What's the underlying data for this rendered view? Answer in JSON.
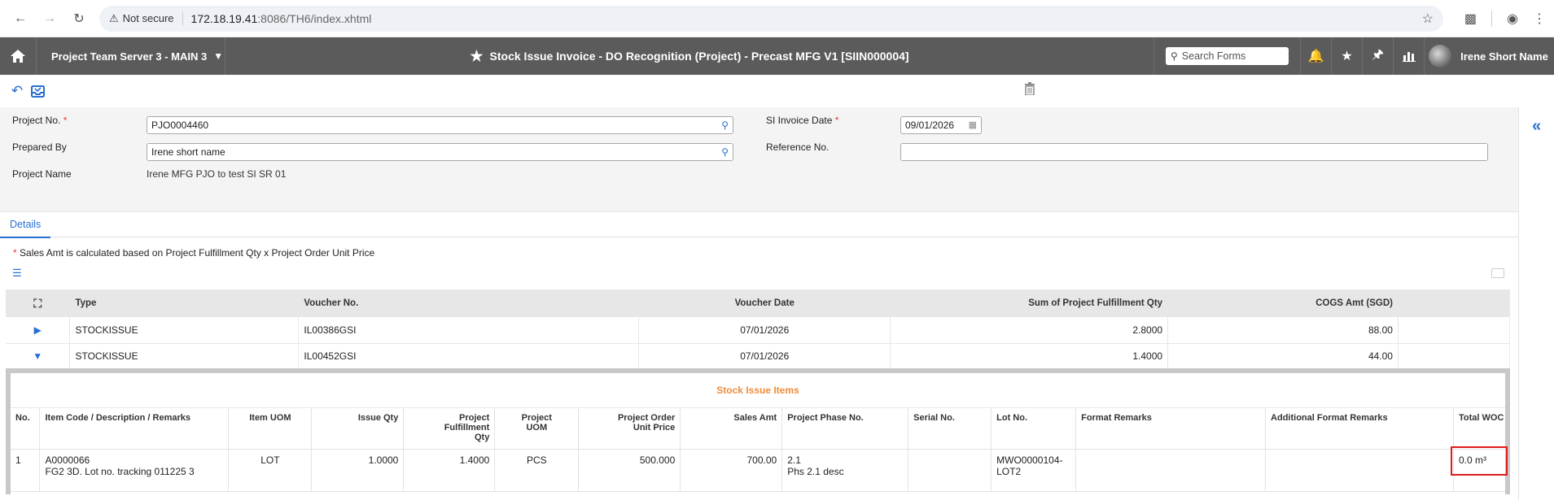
{
  "browser": {
    "security_label": "Not secure",
    "url_host": "172.18.19.41",
    "url_path": ":8086/TH6/index.xhtml"
  },
  "header": {
    "server": "Project Team Server 3 - MAIN 3",
    "title": "Stock Issue Invoice - DO Recognition (Project) - Precast MFG V1 [SIIN000004]",
    "search_placeholder": "Search Forms",
    "user": "Irene Short Name"
  },
  "form": {
    "project_no_label": "Project No.",
    "project_no_value": "PJO0004460",
    "prepared_by_label": "Prepared By",
    "prepared_by_value": "Irene short name",
    "project_name_label": "Project Name",
    "project_name_value": "Irene MFG PJO to test SI SR 01",
    "si_date_label": "SI Invoice Date",
    "si_date_value": "09/01/2026",
    "reference_label": "Reference No.",
    "reference_value": "",
    "required_mark": "*"
  },
  "tabs": [
    {
      "label": "Details"
    }
  ],
  "note": {
    "star": "*",
    "text": "Sales Amt is calculated based on Project Fulfillment Qty x Project Order Unit Price"
  },
  "main_table": {
    "columns": [
      "Type",
      "Voucher No.",
      "Voucher Date",
      "Sum of Project Fulfillment Qty",
      "COGS Amt (SGD)"
    ],
    "rows": [
      {
        "type": "STOCKISSUE",
        "voucher_no": "IL00386GSI",
        "date": "07/01/2026",
        "qty": "2.8000",
        "cogs": "88.00",
        "expanded": false
      },
      {
        "type": "STOCKISSUE",
        "voucher_no": "IL00452GSI",
        "date": "07/01/2026",
        "qty": "1.4000",
        "cogs": "44.00",
        "expanded": true
      }
    ]
  },
  "nested": {
    "title": "Stock Issue Items",
    "columns": {
      "no": "No.",
      "item": "Item Code / Description / Remarks",
      "uom": "Item UOM",
      "issue_qty": "Issue Qty",
      "pf_qty_1": "Project",
      "pf_qty_2": "Fulfillment",
      "pf_qty_3": "Qty",
      "puom_1": "Project",
      "puom_2": "UOM",
      "pou_1": "Project Order",
      "pou_2": "Unit Price",
      "sales_amt": "Sales Amt",
      "phase": "Project Phase No.",
      "serial": "Serial No.",
      "lot": "Lot No.",
      "fmt": "Format Remarks",
      "addfmt": "Additional Format Remarks",
      "woc": "Total WOC A"
    },
    "row": {
      "no": "1",
      "item_code": "A0000066",
      "item_desc": "FG2 3D. Lot no. tracking 011225 3",
      "uom": "LOT",
      "issue_qty": "1.0000",
      "pf_qty": "1.4000",
      "puom": "PCS",
      "pou": "500.000",
      "sales_amt": "700.00",
      "phase_no": "2.1",
      "phase_desc": "Phs 2.1 desc",
      "serial": "",
      "lot_1": "MWO0000104-",
      "lot_2": "LOT2",
      "fmt": "",
      "addfmt": "",
      "woc": "0.0 m³"
    }
  },
  "colors": {
    "header_bg": "#5b5b5b",
    "accent_blue": "#2a6fd0",
    "nested_title": "#f08c3a",
    "highlight_red": "#e01b1b"
  }
}
